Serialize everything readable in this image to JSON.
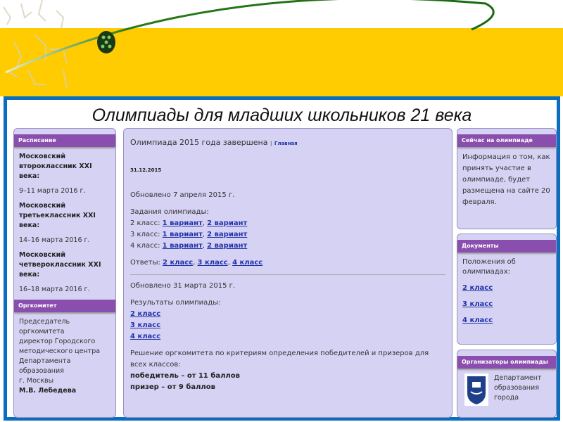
{
  "page_title": "Олимпиады для младших школьников 21 века",
  "left": {
    "schedule": {
      "header": "Расписание",
      "items": [
        {
          "name": "Московский второклассник XXI века:",
          "dates": "9–11 марта 2016 г."
        },
        {
          "name": "Московский третьеклассник XXI века:",
          "dates": "14–16 марта 2016 г."
        },
        {
          "name": "Московский четвероклассник XXI века:",
          "dates": "16–18 марта 2016 г."
        }
      ]
    },
    "committee": {
      "header": "Оргкомитет",
      "lines": [
        "Председатель оргкомитета",
        "директор Городского",
        "методического центра",
        "Департамента образования",
        "г. Москвы"
      ],
      "person": "М.В. Лебедева"
    }
  },
  "main": {
    "heading": "Олимпиада 2015 года завершена",
    "home_sep": "|",
    "home_link": "Главная",
    "date": "31.12.2015",
    "updated1": "Обновлено 7 апреля 2015 г.",
    "tasks_label": "Задания олимпиады:",
    "tasks": [
      {
        "grade": "2 класс:",
        "v1": "1 вариант",
        "v2": "2 вариант"
      },
      {
        "grade": "3 класс:",
        "v1": "1 вариант",
        "v2": "2 вариант"
      },
      {
        "grade": "4 класс:",
        "v1": "1 вариант",
        "v2": "2 вариант"
      }
    ],
    "answers_label": "Ответы:",
    "answers": [
      "2 класс",
      "3 класс",
      "4 класс"
    ],
    "updated2": "Обновлено 31 марта 2015 г.",
    "results_label": "Результаты олимпиады:",
    "results": [
      "2 класс",
      "3 класс",
      "4 класс"
    ],
    "decision": "Решение оргкомитета по критериям определения победителей и призеров для всех классов:",
    "winner": "победитель – от 11 баллов",
    "prize": "призер – от 9 баллов"
  },
  "right": {
    "now": {
      "header": "Сейчас на олимпиаде",
      "text": "Информация о том, как принять участие в олимпиаде, будет размещена на сайте 20 февраля."
    },
    "docs": {
      "header": "Документы",
      "label": "Положения об олимпиадах:",
      "links": [
        "2 класс",
        "3 класс",
        "4 класс"
      ]
    },
    "org": {
      "header": "Организаторы олимпиады",
      "text": "Департамент образования города"
    }
  },
  "colors": {
    "band": "#fecc00",
    "frame": "#0a6ec0",
    "header": "#8a4fae",
    "box": "#d6d2f4"
  }
}
